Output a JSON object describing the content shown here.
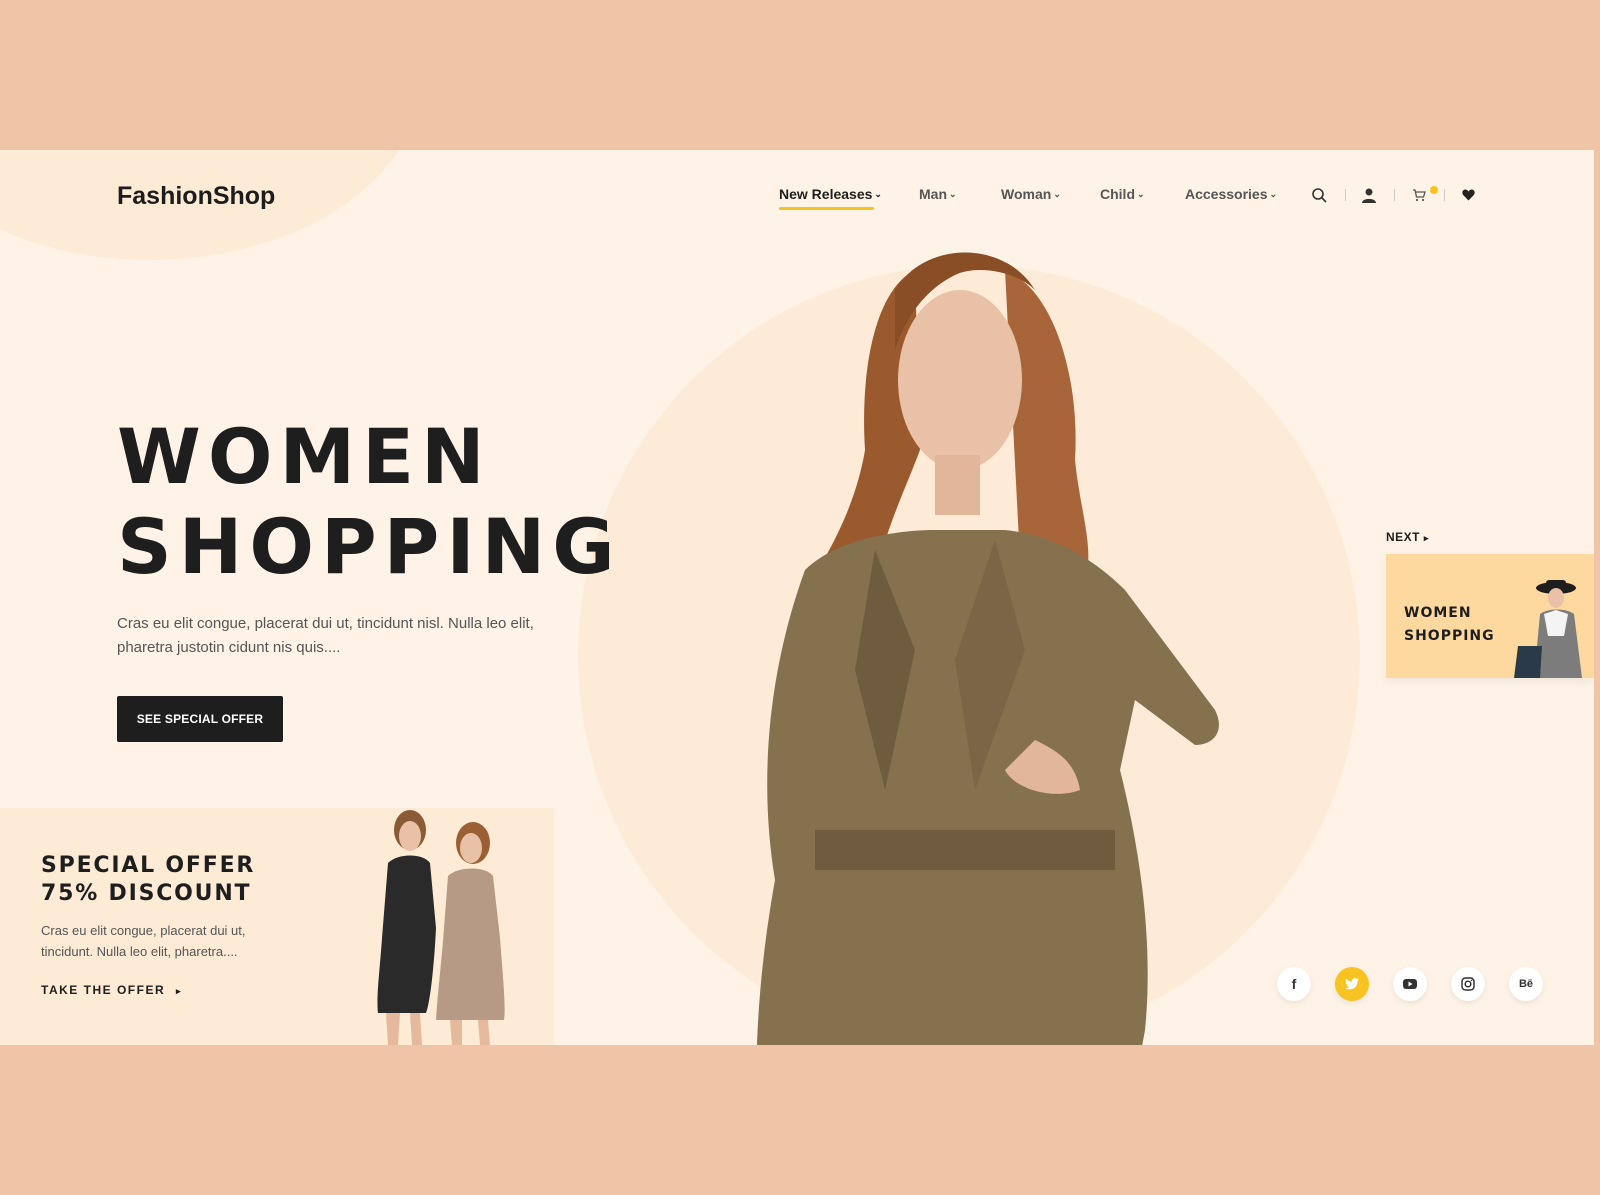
{
  "logo": "FashionShop",
  "nav": {
    "items": [
      {
        "label": "New Releases",
        "active": true
      },
      {
        "label": "Man",
        "active": false
      },
      {
        "label": "Woman",
        "active": false
      },
      {
        "label": "Child",
        "active": false
      },
      {
        "label": "Accessories",
        "active": false
      }
    ],
    "chevron": "⌄"
  },
  "header_icons": [
    "search-icon",
    "user-icon",
    "cart-icon",
    "heart-icon"
  ],
  "hero": {
    "title_line1": "WOMEN",
    "title_line2": "SHOPPING",
    "description": "Cras eu elit congue, placerat dui ut, tincidunt nisl. Nulla leo elit, pharetra justotin cidunt nis quis....",
    "cta_label": "SEE SPECIAL OFFER"
  },
  "offer": {
    "title_line1": "SPECIAL OFFER",
    "title_line2": "75% DISCOUNT",
    "description": "Cras eu elit congue, placerat dui ut, tincidunt. Nulla leo elit, pharetra....",
    "link_label": "TAKE THE OFFER",
    "link_arrow": "▸"
  },
  "next": {
    "label": "NEXT",
    "arrow": "▸",
    "card_title_line1": "WOMEN",
    "card_title_line2": "SHOPPING"
  },
  "socials": [
    {
      "name": "facebook-icon",
      "glyph": "f",
      "active": false
    },
    {
      "name": "twitter-icon",
      "glyph": "",
      "active": true
    },
    {
      "name": "youtube-icon",
      "glyph": "",
      "active": false
    },
    {
      "name": "instagram-icon",
      "glyph": "",
      "active": false
    },
    {
      "name": "behance-icon",
      "glyph": "Bē",
      "active": false
    }
  ],
  "colors": {
    "band": "#f0c4a6",
    "stage": "#fef3e6",
    "accent": "#f7c320",
    "dark": "#1e1e1e"
  }
}
